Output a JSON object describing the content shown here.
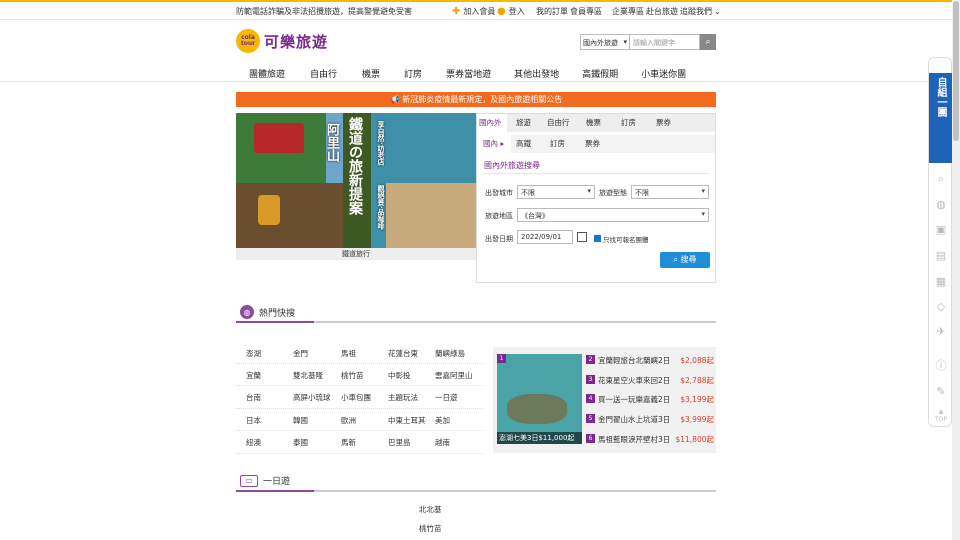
{
  "topbar": {
    "notice": "防範電話詐騙及非法招攬旅遊，提高警覺避免受害",
    "links": [
      {
        "label": "加入會員",
        "icon": "plus-icon"
      },
      {
        "label": "登入",
        "icon": "user-icon"
      },
      {
        "label": "我的訂單"
      },
      {
        "label": "會員專區"
      },
      {
        "label": "企業專區"
      },
      {
        "label": "赴台旅遊"
      },
      {
        "label": "追蹤我們"
      }
    ]
  },
  "logo": {
    "badge": "cola tour",
    "text": "可樂旅遊"
  },
  "search": {
    "scope": "國內外旅遊",
    "placeholder": "請輸入關鍵字"
  },
  "mainnav": [
    "團體旅遊",
    "自由行",
    "機票",
    "訂房",
    "票券當地遊",
    "其他出發地",
    "高鐵假期",
    "小車迷你團"
  ],
  "alert": "新冠肺炎疫情最新規定，及國內旅遊相關公告",
  "banner": {
    "place": "阿里山",
    "headline": "鐵道の旅新提案",
    "sub1": "享自然‧訪老店",
    "sub2": "觀絕景‧品咖啡",
    "caption": "鐵道旅行"
  },
  "search_panel": {
    "tabs1": [
      {
        "label": "國內外 ▸",
        "active": true
      },
      {
        "label": "旅遊"
      },
      {
        "label": "自由行"
      },
      {
        "label": "機票"
      },
      {
        "label": "訂房"
      },
      {
        "label": "票券"
      }
    ],
    "tabs2": [
      {
        "label": "國內 ▸",
        "active": true
      },
      {
        "label": "高鐵"
      },
      {
        "label": "訂房"
      },
      {
        "label": "票券"
      }
    ],
    "title": "國內外旅遊搜尋",
    "depart_city_label": "出發城市",
    "depart_city_value": "不限",
    "tour_type_label": "旅遊型態",
    "tour_type_value": "不限",
    "region_label": "旅遊地區",
    "region_value": "《台灣》",
    "date_label": "出發日期",
    "date_value": "2022/09/01",
    "only_available": "只找可報名團體",
    "submit": "搜尋"
  },
  "hot": {
    "title": "熱門快搜",
    "rows": [
      [
        "澎湖",
        "金門",
        "馬祖",
        "花蓮台東",
        "蘭嶼綠島"
      ],
      [
        "宜蘭",
        "雙北基隆",
        "桃竹苗",
        "中彰投",
        "雲嘉阿里山"
      ],
      [
        "台南",
        "高屏小琉球",
        "小車包團",
        "主題玩法",
        "一日遊"
      ],
      [
        "日本",
        "韓國",
        "歐洲",
        "中東土耳其",
        "美加"
      ],
      [
        "紐澳",
        "泰國",
        "馬新",
        "巴里島",
        "越南"
      ]
    ]
  },
  "promo": {
    "image_caption": "澎湖七美3日$11,000起",
    "image_num": "1",
    "items": [
      {
        "num": "2",
        "name": "宜蘭輕旅台北蘭嶼2日",
        "price": "$2,088起"
      },
      {
        "num": "3",
        "name": "花東星空火車來回2日",
        "price": "$2,788起"
      },
      {
        "num": "4",
        "name": "買一送一玩樂嘉義2日",
        "price": "$3,199起"
      },
      {
        "num": "5",
        "name": "金門翟山水上坑道3日",
        "price": "$3,999起"
      },
      {
        "num": "6",
        "name": "馬祖藍眼淚芹壁村3日",
        "price": "$11,800起"
      }
    ]
  },
  "dayTrip": {
    "title": "一日遊",
    "items": [
      "北北基",
      "桃竹苗"
    ]
  },
  "dock": {
    "highlight": "自組一團",
    "top": "TOP"
  }
}
